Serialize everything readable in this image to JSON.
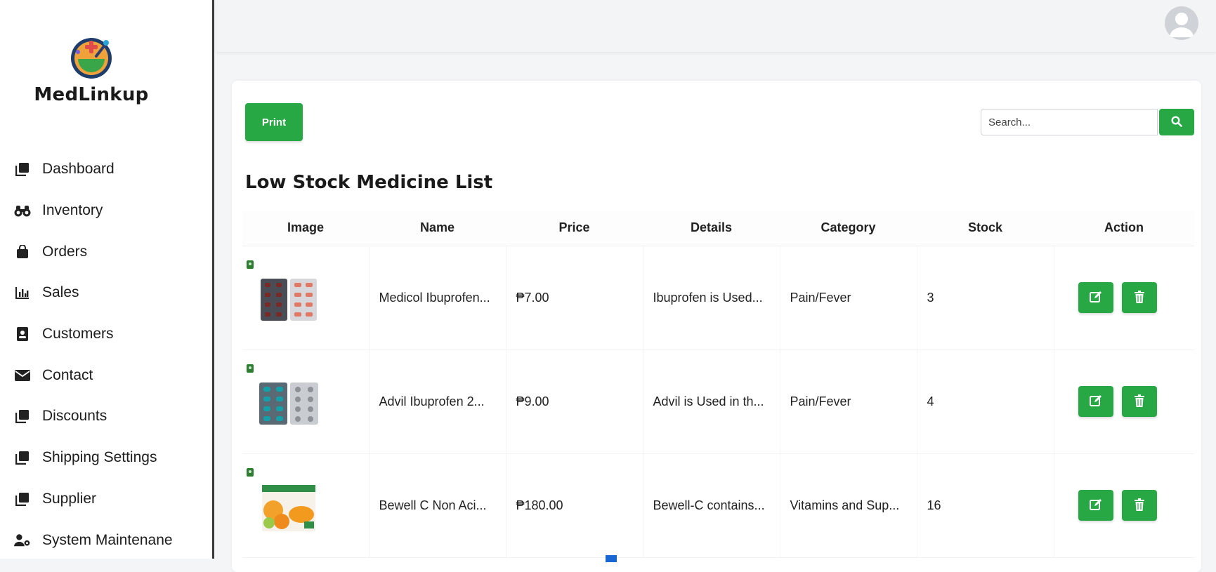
{
  "app": {
    "brand_name": "MedLinkup",
    "logo_icon": "mortar-pestle-logo",
    "accent_color": "#27a844",
    "price_color": "#1766d1"
  },
  "sidebar": {
    "items": [
      {
        "label": "Dashboard",
        "icon": "stack-icon"
      },
      {
        "label": "Inventory",
        "icon": "binoculars-icon"
      },
      {
        "label": "Orders",
        "icon": "shopping-bag-icon"
      },
      {
        "label": "Sales",
        "icon": "bar-chart-icon"
      },
      {
        "label": "Customers",
        "icon": "id-badge-icon"
      },
      {
        "label": "Contact",
        "icon": "envelope-icon"
      },
      {
        "label": "Discounts",
        "icon": "stack-icon"
      },
      {
        "label": "Shipping Settings",
        "icon": "stack-icon"
      },
      {
        "label": "Supplier",
        "icon": "stack-icon"
      },
      {
        "label": "System Maintenane",
        "icon": "user-gear-icon"
      }
    ]
  },
  "topbar": {
    "avatar_icon": "user-avatar-icon"
  },
  "toolbar": {
    "print_label": "Print",
    "search_placeholder": "Search..."
  },
  "page": {
    "title": "Low Stock Medicine List"
  },
  "table": {
    "headers": [
      "Image",
      "Name",
      "Price",
      "Details",
      "Category",
      "Stock",
      "Action"
    ],
    "rows": [
      {
        "name": "Medicol Ibuprofen...",
        "price": "₱7.00",
        "details": "Ibuprofen is Used...",
        "category": "Pain/Fever",
        "stock": "3",
        "image": "blister-pack-red"
      },
      {
        "name": "Advil Ibuprofen 2...",
        "price": "₱9.00",
        "details": "Advil is Used in th...",
        "category": "Pain/Fever",
        "stock": "4",
        "image": "blister-pack-teal"
      },
      {
        "name": "Bewell C Non Aci...",
        "price": "₱180.00",
        "details": "Bewell-C contains...",
        "category": "Vitamins and Sup...",
        "stock": "16",
        "image": "vitamin-box-orange"
      }
    ],
    "row_actions": {
      "edit_icon": "edit-icon",
      "delete_icon": "trash-icon"
    }
  }
}
